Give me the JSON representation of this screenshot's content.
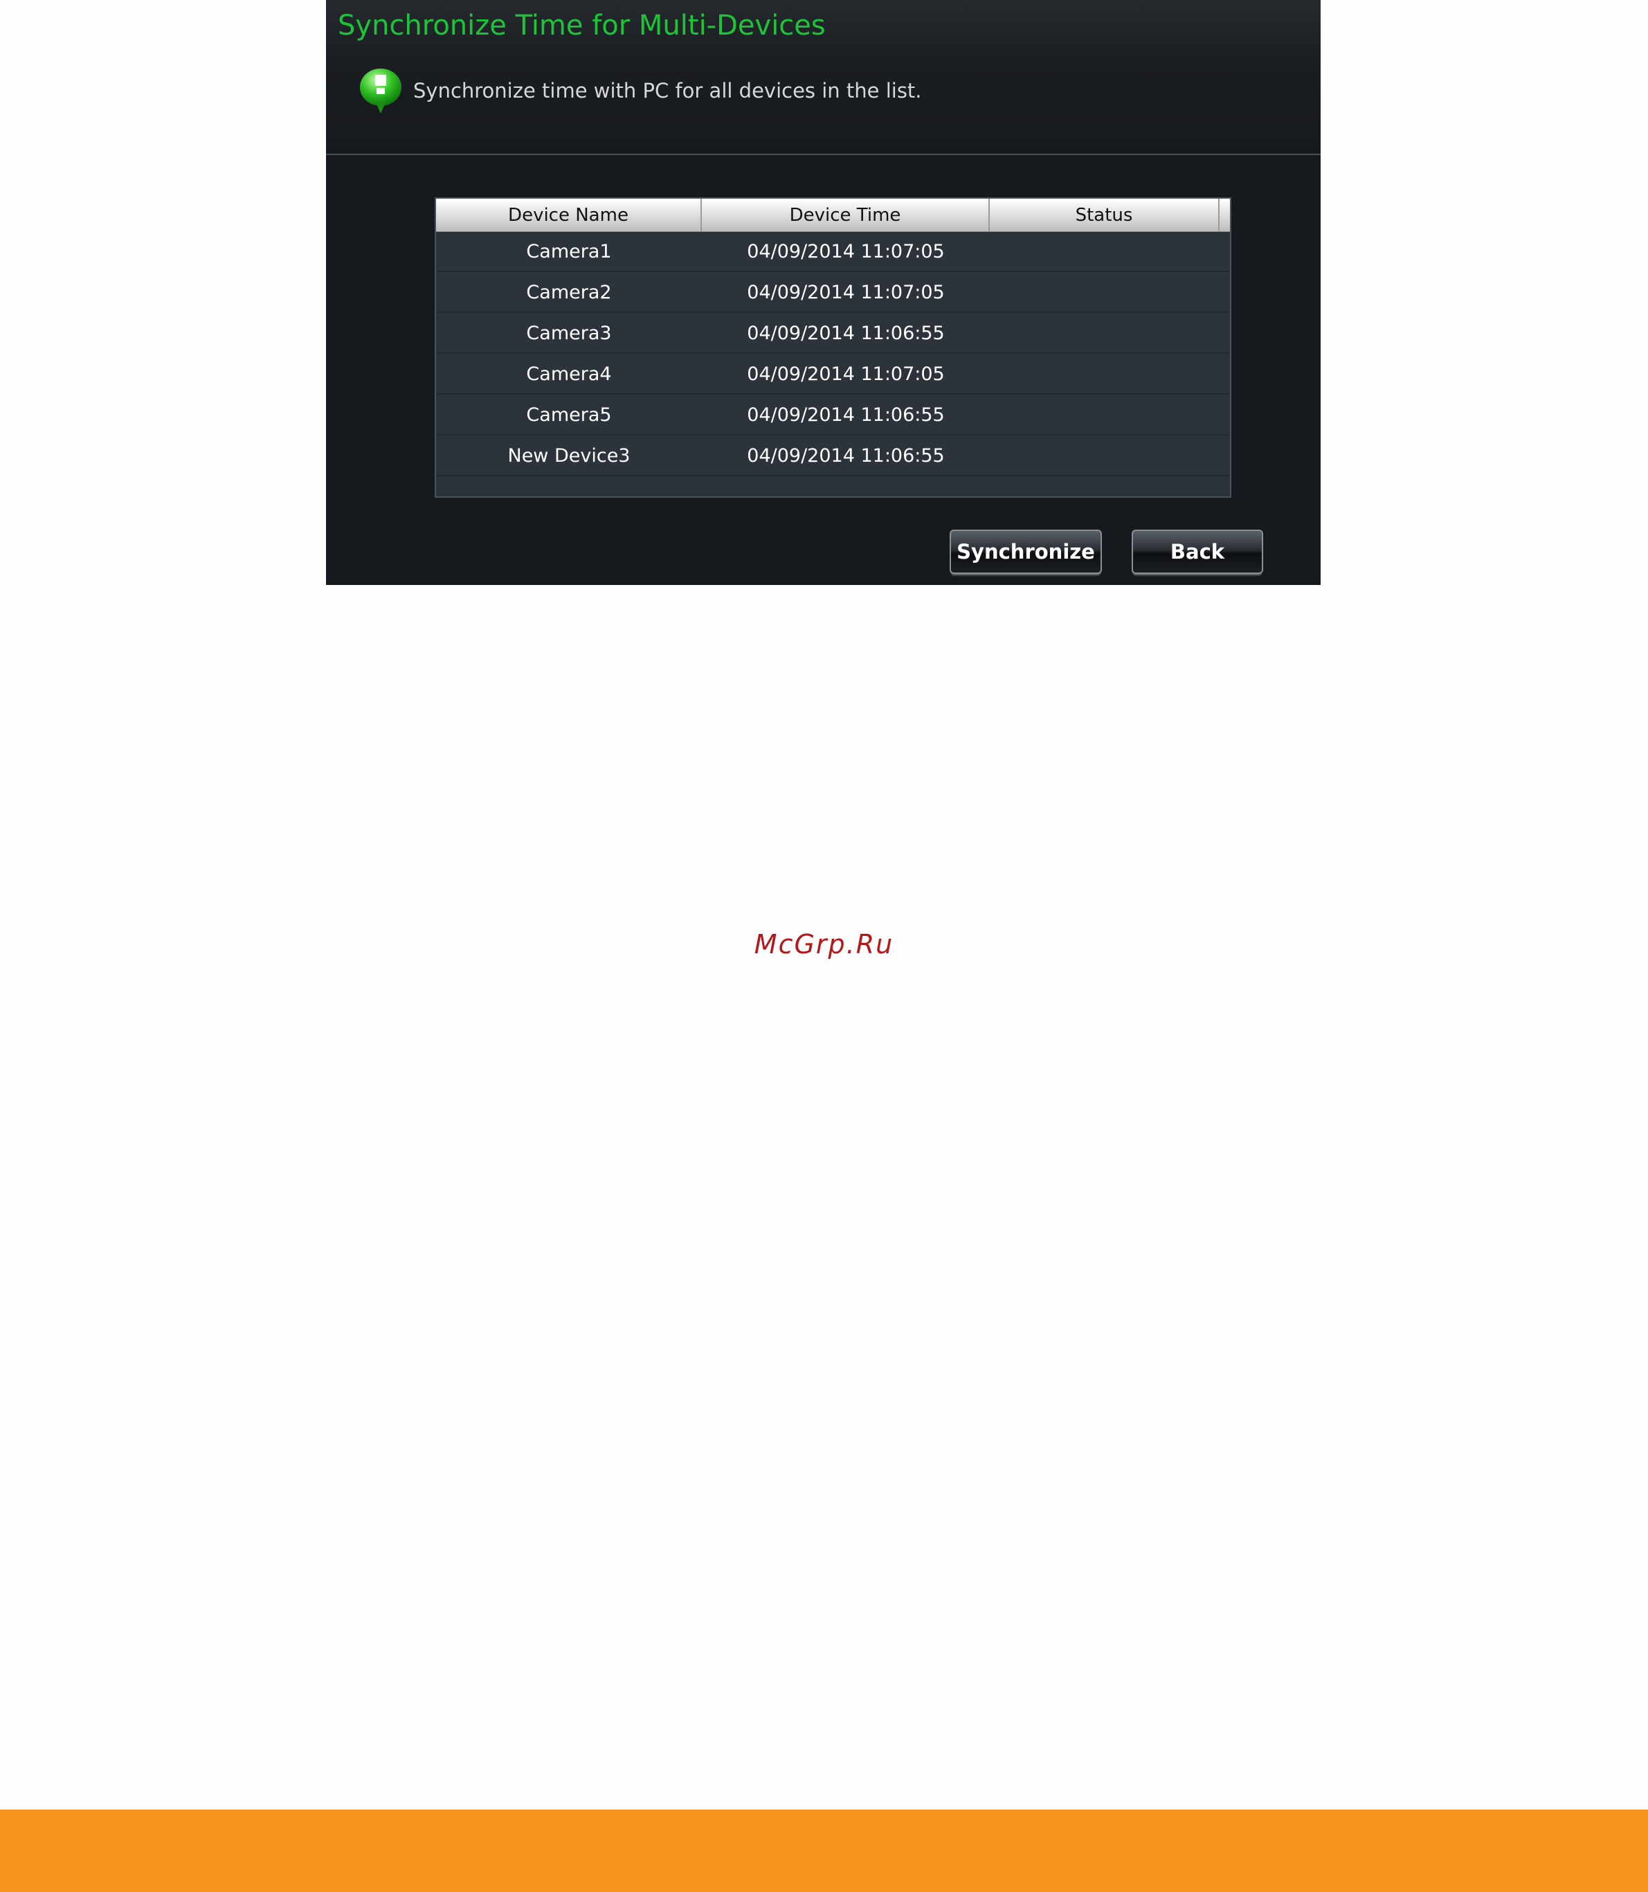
{
  "dialog": {
    "title": "Synchronize Time for Multi-Devices",
    "subtitle": "Synchronize time with PC for all devices in the list."
  },
  "table": {
    "columns": {
      "name": "Device Name",
      "time": "Device Time",
      "status": "Status"
    },
    "rows": [
      {
        "name": "Camera1",
        "time": "04/09/2014 11:07:05",
        "status": ""
      },
      {
        "name": "Camera2",
        "time": "04/09/2014 11:07:05",
        "status": ""
      },
      {
        "name": "Camera3",
        "time": "04/09/2014 11:06:55",
        "status": ""
      },
      {
        "name": "Camera4",
        "time": "04/09/2014 11:07:05",
        "status": ""
      },
      {
        "name": "Camera5",
        "time": "04/09/2014 11:06:55",
        "status": ""
      },
      {
        "name": "New Device3",
        "time": "04/09/2014 11:06:55",
        "status": ""
      }
    ]
  },
  "buttons": {
    "synchronize": "Synchronize",
    "back": "Back"
  },
  "watermark": "McGrp.Ru",
  "colors": {
    "title_green": "#1ec438",
    "panel_bg": "#16191d",
    "table_bg": "#2c333b",
    "footer_orange": "#f7931e",
    "watermark_red": "#b11a1a"
  }
}
